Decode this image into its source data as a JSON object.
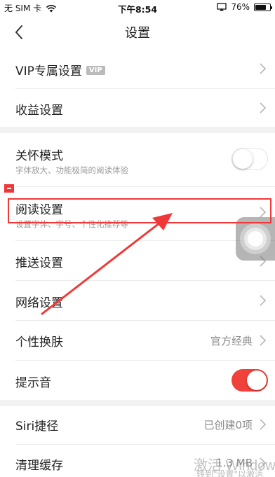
{
  "status_bar": {
    "carrier": "无 SIM 卡",
    "time": "下午8:54",
    "battery": "76%",
    "battery_level": 0.76,
    "icons": [
      "wifi-icon",
      "screen-mirroring-icon",
      "battery-icon"
    ]
  },
  "nav": {
    "title": "设置",
    "back_icon": "chevron-left-icon"
  },
  "rows": {
    "vip": {
      "label": "VIP专属设置",
      "badge": "VIP"
    },
    "earnings": {
      "label": "收益设置"
    },
    "care_mode": {
      "label": "关怀模式",
      "sub": "字体放大、功能极简的阅读体验",
      "toggle": false
    },
    "reading": {
      "label": "阅读设置",
      "sub": "设置字体、字号、个性化推荐等"
    },
    "push": {
      "label": "推送设置"
    },
    "network": {
      "label": "网络设置"
    },
    "skin": {
      "label": "个性换肤",
      "value": "官方经典"
    },
    "sound": {
      "label": "提示音",
      "toggle": true
    },
    "siri": {
      "label": "Siri捷径",
      "value": "已创建0项"
    },
    "cache": {
      "label": "清理缓存",
      "value": "1.3 MB"
    }
  },
  "overlay": {
    "watermark": "激活 Window",
    "watermark_sub": "转到\"设置\"以激活"
  },
  "colors": {
    "accent": "#f0413a",
    "annotation": "#f03838",
    "divider": "#ececec",
    "section_gap": "#f2f2f2"
  }
}
